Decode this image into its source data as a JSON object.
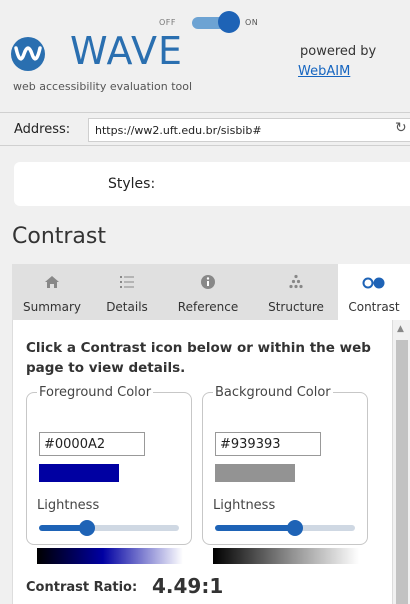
{
  "header": {
    "logo_text": "WAVE",
    "tagline": "web accessibility evaluation tool",
    "powered_by": "powered by",
    "webaim_link": "WebAIM"
  },
  "address": {
    "label": "Address:",
    "value": "https://ww2.uft.edu.br/sisbib#"
  },
  "styles": {
    "label": "Styles:",
    "off": "OFF",
    "on": "ON",
    "enabled": true
  },
  "section_title": "Contrast",
  "tabs": [
    {
      "label": "Summary",
      "icon": "home-icon",
      "active": false
    },
    {
      "label": "Details",
      "icon": "list-icon",
      "active": false
    },
    {
      "label": "Reference",
      "icon": "info-icon",
      "active": false
    },
    {
      "label": "Structure",
      "icon": "structure-icon",
      "active": false
    },
    {
      "label": "Contrast",
      "icon": "contrast-icon",
      "active": true
    }
  ],
  "panel": {
    "intro": "Click a Contrast icon below or within the web page to view details.",
    "foreground": {
      "legend": "Foreground Color",
      "hex": "#0000A2",
      "swatch_color": "#0000a2",
      "lightness_label": "Lightness",
      "lightness": 0.38
    },
    "background": {
      "legend": "Background Color",
      "hex": "#939393",
      "swatch_color": "#939393",
      "lightness_label": "Lightness",
      "lightness": 0.58
    },
    "ratio_label": "Contrast Ratio:",
    "ratio_value": "4.49:1"
  },
  "colors": {
    "accent": "#1e63b6",
    "link": "#1565c0"
  }
}
